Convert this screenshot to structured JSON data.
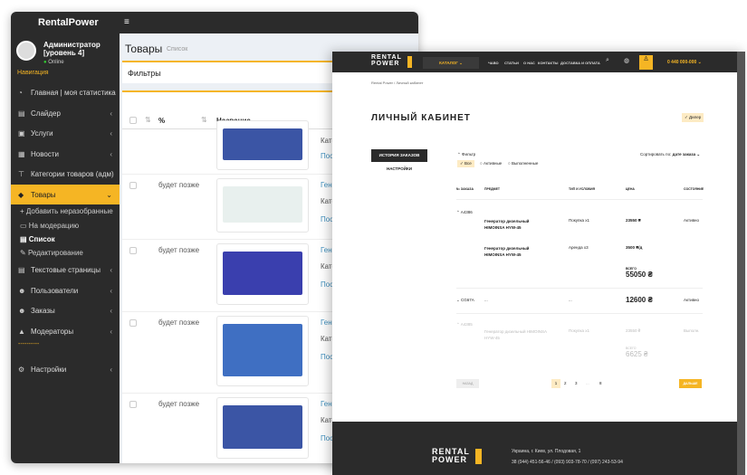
{
  "admin": {
    "brand": "RentalPower",
    "user": {
      "name": "Администратор",
      "level": "[уровень 4]",
      "status": "Online"
    },
    "nav_header": "Навигация",
    "nav": [
      {
        "label": "Главная | моя статистика",
        "icon": "dashboard-icon"
      },
      {
        "label": "Слайдер",
        "icon": "file-icon"
      },
      {
        "label": "Услуги",
        "icon": "briefcase-icon"
      },
      {
        "label": "Новости",
        "icon": "newspaper-icon"
      },
      {
        "label": "Категории товаров (адм)",
        "icon": "sitemap-icon"
      },
      {
        "label": "Товары",
        "icon": "tag-icon"
      },
      {
        "label": "Текстовые страницы",
        "icon": "file-icon"
      },
      {
        "label": "Пользователи",
        "icon": "users-icon"
      },
      {
        "label": "Заказы",
        "icon": "users-icon"
      },
      {
        "label": "Модераторы",
        "icon": "lock-icon"
      },
      {
        "label": "Настройки",
        "icon": "cogs-icon"
      }
    ],
    "submenu": [
      "Добавить неразобранные",
      "На модерацию",
      "Список",
      "Редактирование"
    ],
    "separator": "----------",
    "page_title": "Товары",
    "page_sub": "Список",
    "filters": "Фильтры",
    "columns": {
      "percent": "%",
      "name": "Название"
    },
    "rows": [
      {
        "percent": "",
        "c1": "",
        "c2": "Кате",
        "c3": "Пос",
        "color": "#3b55a5"
      },
      {
        "percent": "будет позже",
        "c1": "Гене",
        "c2": "Кате",
        "c3": "Пос",
        "color": "#e8f0ee"
      },
      {
        "percent": "будет позже",
        "c1": "Гене",
        "c2": "Кате",
        "c3": "Пос",
        "color": "#3a3fae"
      },
      {
        "percent": "будет позже",
        "c1": "Гене",
        "c2": "Кате",
        "c3": "Пос",
        "color": "#3f6fc2"
      },
      {
        "percent": "будет позже",
        "c1": "Гене",
        "c2": "Кате",
        "c3": "Пос",
        "color": "#3b55a5"
      }
    ]
  },
  "site": {
    "logo": [
      "RENTAL",
      "POWER"
    ],
    "catalog": "КАТАЛОГ ⌄",
    "menu": [
      "ЧАВО",
      "СТАТЬИ",
      "О НАС",
      "КОНТАКТЫ",
      "ДОСТАВКА И ОПЛАТА"
    ],
    "phone": "0 440 000-000 ⌄",
    "breadcrumb": "Rental Power / Личный кабинет",
    "title": "ЛИЧНЫЙ КАБИНЕТ",
    "badge": "✓ Дилер",
    "tabs": [
      "ИСТОРИЯ ЗАКАЗОВ",
      "НАСТРОЙКИ"
    ],
    "filter_label": "⌃ Фильтр",
    "filters": [
      "✓ Все",
      "Активные",
      "Выполненные"
    ],
    "sort_label": "Сортировать по:",
    "sort_value": "дате заказа ⌄",
    "headers": [
      "№ ЗАКАЗА",
      "ПРЕДМЕТ",
      "ТИП И УСЛОВИЯ",
      "ЦЕНА",
      "СОСТОЯНИЕ"
    ],
    "orders": [
      {
        "id": "⌃ A4386",
        "items": [
          {
            "item": "Генератор дизельный HIMOINSA HYW-45",
            "type": "Покупка x1",
            "price": "23550 ₴"
          },
          {
            "item": "Генератор дизельный HIMOINSA HYW-45",
            "type": "Аренда x3",
            "price": "3500 ₴/д"
          }
        ],
        "total_label": "ВСЕГО",
        "total": "55050 ₴",
        "status": "Активно"
      },
      {
        "id": "⌄ CG67A",
        "item": "...",
        "type": "...",
        "total": "12600 ₴",
        "status": "Активно"
      },
      {
        "id": "⌃ A4385",
        "items": [
          {
            "item": "Генератор дизельный HIMOINSA HYW-45",
            "type": "Покупка x1",
            "price": "23550 ₴"
          }
        ],
        "total_label": "ВСЕГО",
        "total": "6625 ₴",
        "status": "Выполн."
      }
    ],
    "prev": "НАЗАД",
    "pages": [
      "1",
      "2",
      "3",
      "...",
      "8"
    ],
    "next": "ДАЛЬШЕ",
    "footer": {
      "address": "Украина, г. Киев, ул. Плодовая, 1",
      "phones": "38 (044) 451-56-46 / (093) 903-78-70 / (097) 243-53-94"
    }
  }
}
